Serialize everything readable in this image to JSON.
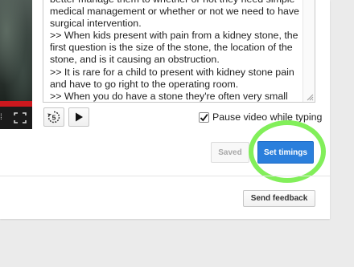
{
  "transcript": {
    "lines": [
      "better manage them to whether or not they need simple",
      "medical management or whether or not we need to have",
      "surgical intervention.",
      ">> When kids present with pain from a kidney stone, the",
      "first question is the size of the stone, the location of the",
      "stone, and is it causing an obstruction.",
      ">> It is rare for a child to present with kidney stone pain",
      "and have to go right to the operating room.",
      ">> When you do have a stone they're often very small"
    ]
  },
  "controls": {
    "replay_seconds": "5",
    "pause_label": "Pause video while typing",
    "pause_checked": true
  },
  "actions": {
    "saved_label": "Saved",
    "set_timings_label": "Set timings",
    "feedback_label": "Send feedback"
  },
  "colors": {
    "primary_button": "#2b7fdc",
    "highlight": "#82ef5a",
    "progress": "#cc181e"
  }
}
